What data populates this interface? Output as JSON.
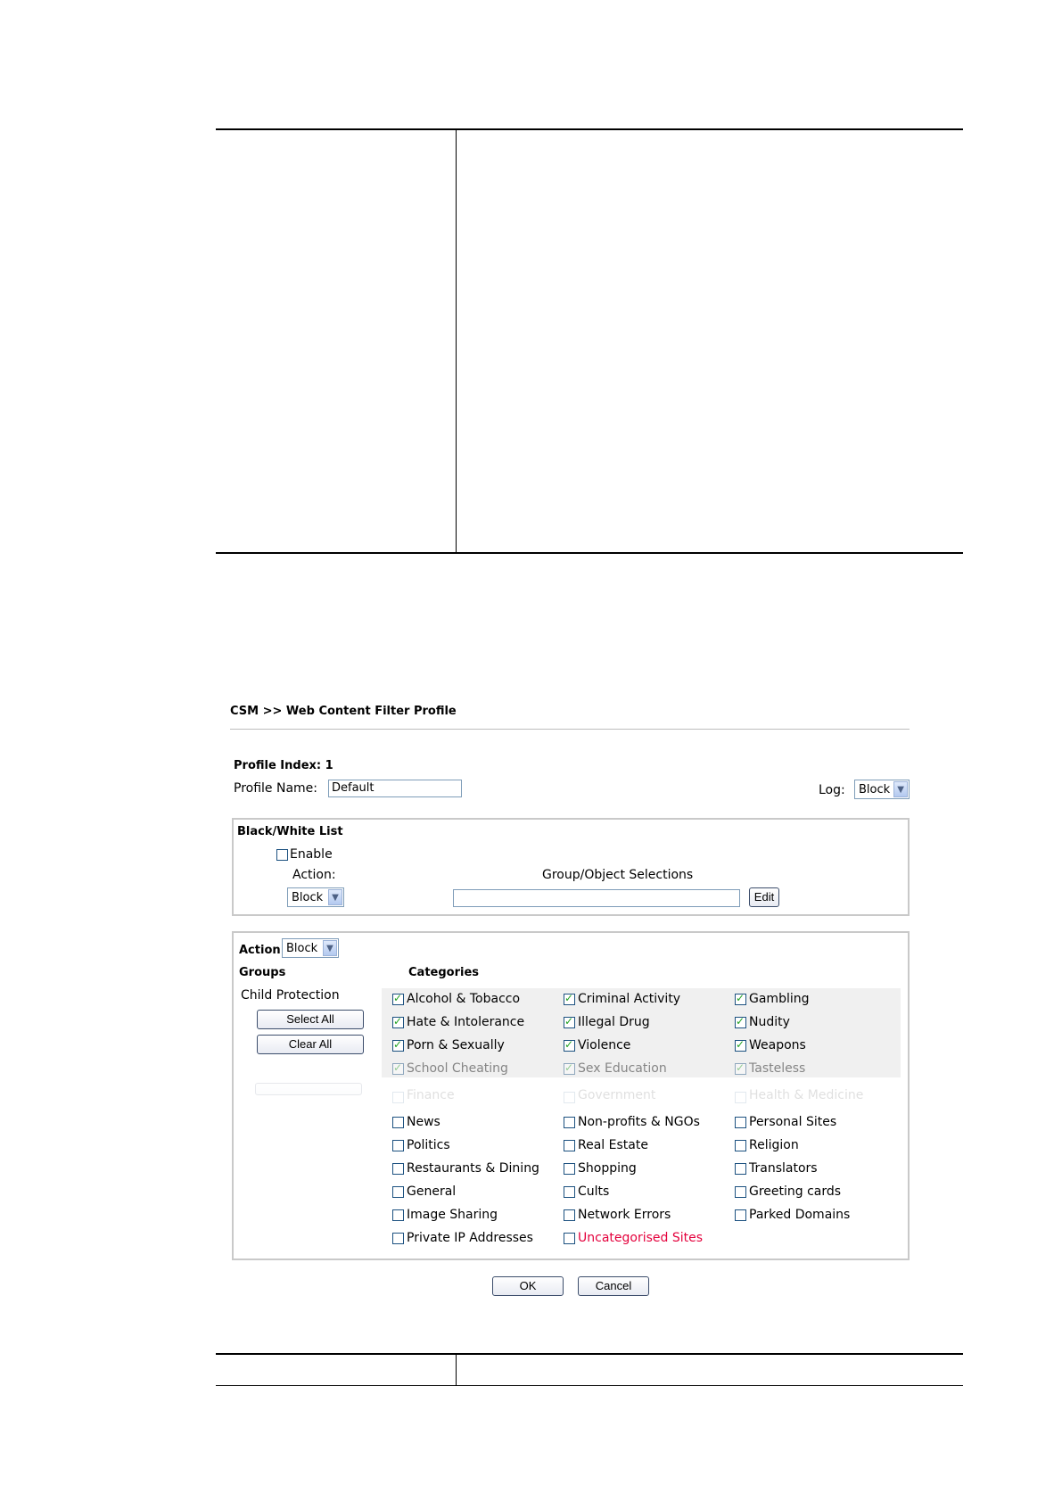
{
  "breadcrumb": "CSM >> Web Content Filter Profile",
  "profile": {
    "index_label": "Profile Index: 1",
    "name_label": "Profile Name:",
    "name_value": "Default",
    "log_label": "Log:",
    "log_value": "Block"
  },
  "bwlist": {
    "title": "Black/White List",
    "enable_label": "Enable",
    "enabled": false,
    "action_label": "Action:",
    "action_value": "Block",
    "group_label": "Group/Object Selections",
    "group_value": "",
    "edit_label": "Edit"
  },
  "categories_box": {
    "action_label": "Action:",
    "action_value": "Block",
    "groups_header": "Groups",
    "categories_header": "Categories",
    "group_name": "Child Protection",
    "select_all": "Select All",
    "clear_all": "Clear All",
    "checked_rows": [
      [
        {
          "label": "Alcohol & Tobacco",
          "checked": true
        },
        {
          "label": "Criminal Activity",
          "checked": true
        },
        {
          "label": "Gambling",
          "checked": true
        }
      ],
      [
        {
          "label": "Hate & Intolerance",
          "checked": true
        },
        {
          "label": "Illegal Drug",
          "checked": true
        },
        {
          "label": "Nudity",
          "checked": true
        }
      ],
      [
        {
          "label": "Porn & Sexually",
          "checked": true
        },
        {
          "label": "Violence",
          "checked": true
        },
        {
          "label": "Weapons",
          "checked": true
        }
      ],
      [
        {
          "label": "School Cheating",
          "checked": true
        },
        {
          "label": "Sex Education",
          "checked": true
        },
        {
          "label": "Tasteless",
          "checked": true
        }
      ]
    ],
    "faded_row": [
      "Finance",
      "Government",
      "Health & Medicine"
    ],
    "unchecked_rows": [
      [
        "News",
        "Non-profits & NGOs",
        "Personal Sites"
      ],
      [
        "Politics",
        "Real Estate",
        "Religion"
      ],
      [
        "Restaurants & Dining",
        "Shopping",
        "Translators"
      ],
      [
        "General",
        "Cults",
        "Greeting cards"
      ],
      [
        "Image Sharing",
        "Network Errors",
        "Parked Domains"
      ],
      [
        "Private IP Addresses",
        "Uncategorised Sites",
        ""
      ]
    ]
  },
  "buttons": {
    "ok": "OK",
    "cancel": "Cancel"
  },
  "colors": {
    "uncategorised": "#e4003c",
    "check": "#21a121"
  }
}
